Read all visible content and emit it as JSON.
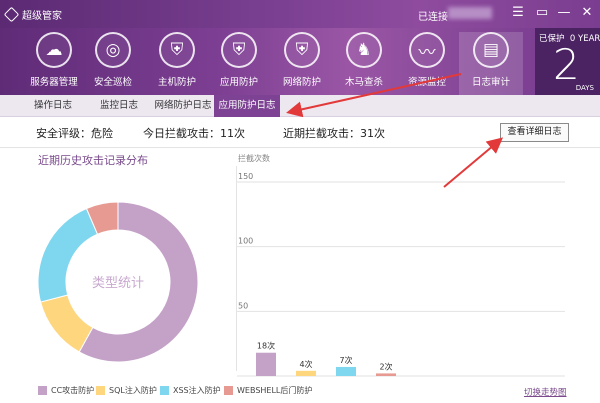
{
  "app": {
    "title": "超级管家"
  },
  "titlebar": {
    "status": "已连接"
  },
  "nav": [
    {
      "label": "服务器管理",
      "icon": "cloud-server-icon",
      "glyph": "☁"
    },
    {
      "label": "安全巡检",
      "icon": "radar-icon",
      "glyph": "◎"
    },
    {
      "label": "主机防护",
      "icon": "shield-icon",
      "glyph": "⛨"
    },
    {
      "label": "应用防护",
      "icon": "app-shield-icon",
      "glyph": "⛨"
    },
    {
      "label": "网络防护",
      "icon": "network-shield-icon",
      "glyph": "⛨"
    },
    {
      "label": "木马查杀",
      "icon": "horse-icon",
      "glyph": "♞"
    },
    {
      "label": "资源监控",
      "icon": "pulse-icon",
      "glyph": "〰"
    },
    {
      "label": "日志审计",
      "icon": "log-icon",
      "glyph": "▤"
    }
  ],
  "protect": {
    "label": "已保护",
    "years": "0 YEAR",
    "days_num": "2",
    "days_label": "DAYS"
  },
  "tabs": [
    "操作日志",
    "监控日志",
    "网络防护日志",
    "应用防护日志"
  ],
  "stats": {
    "level_label": "安全评级：",
    "level_value": "危险",
    "today_label": "今日拦截攻击：",
    "today_value": "11次",
    "recent_label": "近期拦截攻击：",
    "recent_value": "31次"
  },
  "detail_button": "查看详细日志",
  "pie_title": "近期历史攻击记录分布",
  "bar_title": "拦截次数",
  "switch_link": "切换走势图",
  "colors": {
    "accent": "#7d4294",
    "cc": "#c4a2c8",
    "sql": "#fdd67e",
    "xss": "#7fd6ef",
    "webshell": "#e79a91"
  },
  "chart_data": [
    {
      "type": "pie",
      "title": "近期历史攻击记录分布",
      "center_label": "类型统计",
      "categories": [
        "CC攻击防护",
        "SQL注入防护",
        "XSS注入防护",
        "WEBSHELL后门防护"
      ],
      "values": [
        18,
        4,
        7,
        2
      ]
    },
    {
      "type": "bar",
      "title": "拦截次数",
      "categories": [
        "CC攻击防护",
        "SQL注入防护",
        "XSS注入防护",
        "WEBSHELL后门防护"
      ],
      "values": [
        18,
        4,
        7,
        2
      ],
      "data_labels": [
        "18次",
        "4次",
        "7次",
        "2次"
      ],
      "yticks": [
        50,
        100,
        150
      ],
      "ylim": [
        0,
        150
      ]
    }
  ]
}
